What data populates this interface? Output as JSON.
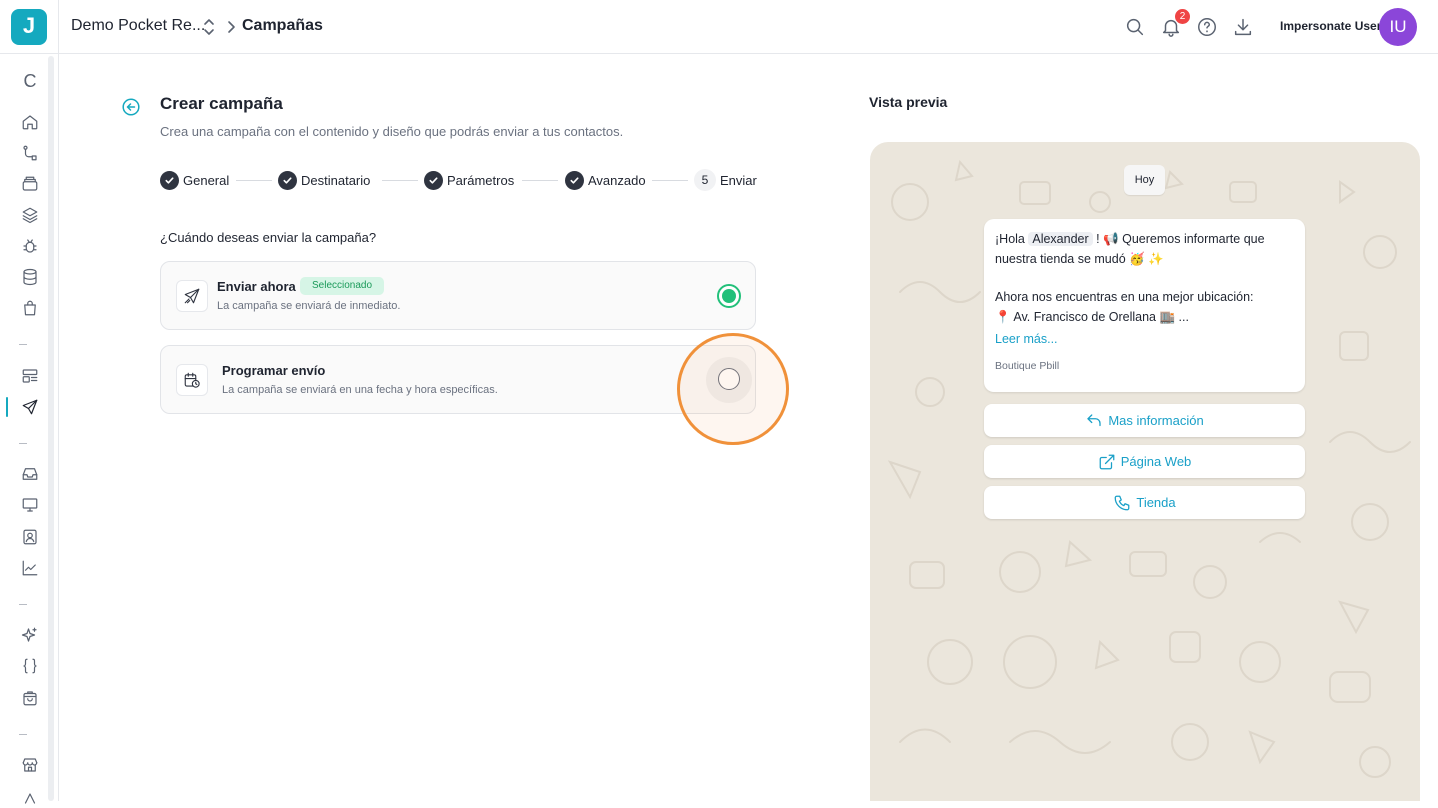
{
  "app": {
    "logo_letter": "J",
    "accent_color": "#15a9bf"
  },
  "header": {
    "workspace": "Demo Pocket Re...",
    "breadcrumb_current": "Campañas",
    "notification_count": "2",
    "user_name": "Impersonate User",
    "avatar_initials": "IU",
    "avatar_color": "#8b46d9"
  },
  "sidebar": {
    "top_glyph": "C",
    "items": [
      "home-icon",
      "flow-icon",
      "archive-icon",
      "layers-icon",
      "bug-icon",
      "database-icon",
      "bag-icon",
      "template-icon",
      "send-icon",
      "inbox-icon",
      "monitor-icon",
      "contact-icon",
      "chart-icon",
      "sparkles-icon",
      "braces-icon",
      "shopping-bag-icon",
      "store-icon"
    ],
    "active_item": "send-icon"
  },
  "form": {
    "title": "Crear campaña",
    "subtitle": "Crea una campaña con el contenido y diseño que podrás enviar a tus contactos.",
    "steps": [
      {
        "label": "General",
        "done": true
      },
      {
        "label": "Destinatario",
        "done": true
      },
      {
        "label": "Parámetros",
        "done": true
      },
      {
        "label": "Avanzado",
        "done": true
      },
      {
        "label": "Enviar",
        "number": "5",
        "done": false
      }
    ],
    "question": "¿Cuándo deseas enviar la campaña?",
    "options": [
      {
        "title": "Enviar ahora",
        "description": "La campaña se enviará de inmediato.",
        "badge": "Seleccionado",
        "selected": true
      },
      {
        "title": "Programar envío",
        "description": "La campaña se enviará en una fecha y hora específicas.",
        "selected": false
      }
    ]
  },
  "preview": {
    "label": "Vista previa",
    "date_chip": "Hoy",
    "message": {
      "line1_prefix": "¡Hola",
      "line1_var": "Alexander",
      "line1_suffix": "! 📢 Queremos informarte que",
      "line2": "nuestra tienda se mudó 🥳 ✨",
      "line3": "Ahora nos encuentras en una mejor ubicación:",
      "line4": "📍 Av. Francisco de Orellana 🏬 ...",
      "read_more": "Leer más...",
      "footer": "Boutique Pbill"
    },
    "buttons": [
      {
        "label": "Mas información",
        "icon": "reply-icon"
      },
      {
        "label": "Página Web",
        "icon": "external-link-icon"
      },
      {
        "label": "Tienda",
        "icon": "phone-icon"
      }
    ]
  }
}
